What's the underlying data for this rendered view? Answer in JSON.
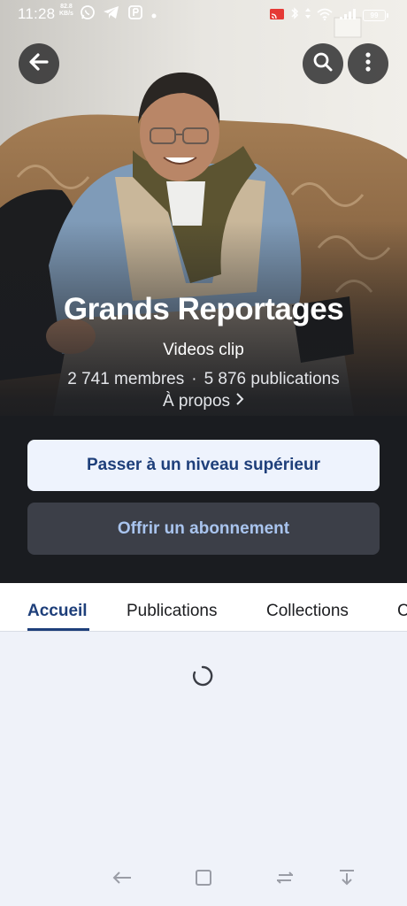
{
  "status_bar": {
    "time": "11:28",
    "net_speed_value": "82.8",
    "net_speed_unit": "KB/s",
    "battery": "99"
  },
  "header": {
    "title": "Grands Reportages",
    "subtitle": "Videos clip",
    "members": "2 741 membres",
    "separator": "·",
    "publications": "5 876 publications",
    "about_label": "À propos"
  },
  "actions": {
    "upgrade_label": "Passer à un niveau supérieur",
    "gift_label": "Offrir un abonnement"
  },
  "tabs": [
    {
      "label": "Accueil",
      "active": true
    },
    {
      "label": "Publications",
      "active": false
    },
    {
      "label": "Collections",
      "active": false
    },
    {
      "label": "C",
      "active": false
    }
  ],
  "colors": {
    "accent": "#1e3f7a",
    "hero_bg": "#1a1c20",
    "page_bg": "#eff2f9"
  },
  "icons": {
    "back": "arrow-left-icon",
    "search": "search-icon",
    "more": "more-vertical-icon",
    "spinner": "loading-spinner-icon"
  }
}
